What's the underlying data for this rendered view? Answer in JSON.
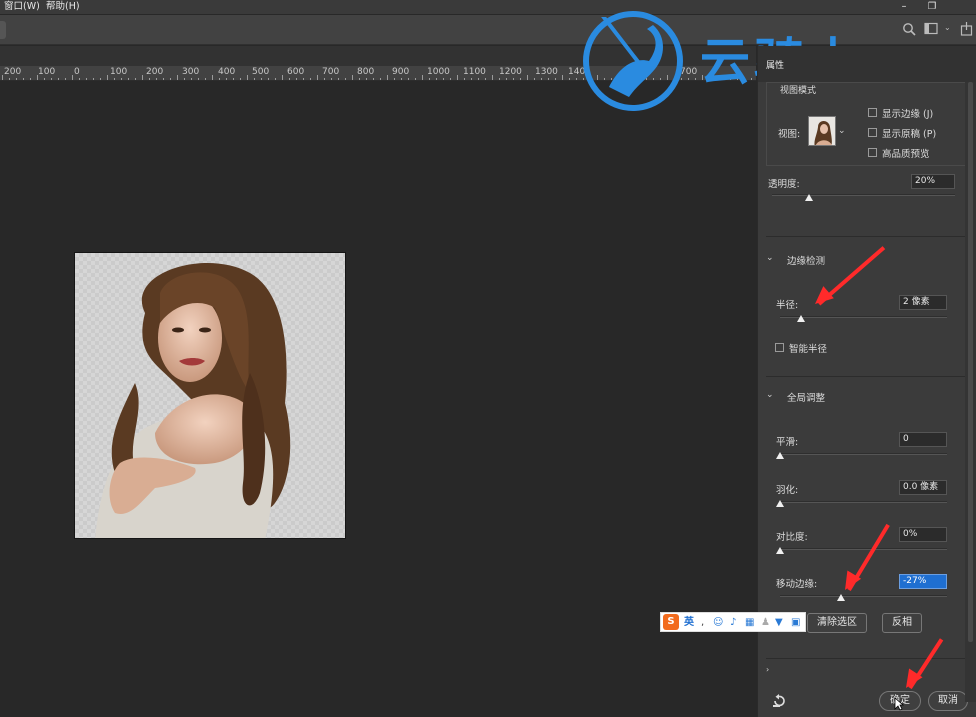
{
  "menubar": {
    "window_menu": "窗口(W)",
    "help_menu": "帮助(H)"
  },
  "ruler": {
    "labels": [
      "200",
      "100",
      "0",
      "100",
      "200",
      "300",
      "400",
      "500",
      "600",
      "700",
      "800",
      "900",
      "1000",
      "1100",
      "1200",
      "1300",
      "140",
      "700"
    ]
  },
  "watermark": {
    "text": "云骑士",
    "color": "#2a8be0"
  },
  "panel": {
    "tab_title": "属性",
    "view_mode": {
      "title": "视图模式",
      "view_label": "视图:",
      "show_edge": "显示边缘 (J)",
      "show_original": "显示原稿 (P)",
      "hq_preview": "高品质预览"
    },
    "transparency": {
      "label": "透明度:",
      "value": "20%",
      "level_percent": 20
    },
    "edge_detection": {
      "title": "边缘检测",
      "radius_label": "半径:",
      "radius_value": "2 像素",
      "smart_radius": "智能半径"
    },
    "global_adjust": {
      "title": "全局调整",
      "smooth_label": "平滑:",
      "smooth_value": "0",
      "feather_label": "羽化:",
      "feather_value": "0.0 像素",
      "contrast_label": "对比度:",
      "contrast_value": "0%",
      "shift_edge_label": "移动边缘:",
      "shift_edge_value": "-27%"
    },
    "buttons": {
      "clear_selection": "清除选区",
      "invert": "反相",
      "ok": "确定",
      "cancel": "取消"
    }
  },
  "ime": {
    "logo": "S",
    "mode": "英"
  },
  "colors": {
    "accent_blue": "#1f6fd1",
    "annotation_red": "#ff2a2a"
  }
}
